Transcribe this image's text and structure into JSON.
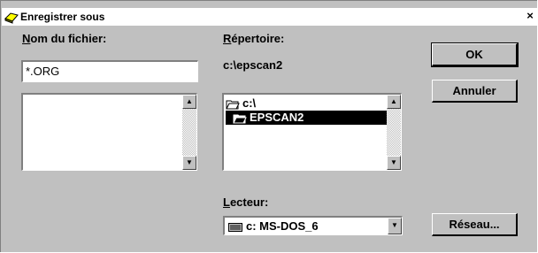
{
  "window": {
    "title": "Enregistrer sous",
    "close_symbol": "×"
  },
  "filename": {
    "label": "Nom du fichier:",
    "label_accel": "N",
    "label_rest": "om du fichier:",
    "value": "*.ORG"
  },
  "directory": {
    "label_accel": "R",
    "label_rest": "épertoire:",
    "current_path": "c:\\epscan2",
    "items": [
      {
        "label": "c:\\",
        "icon": "open-folder-icon",
        "selected": false
      },
      {
        "label": "EPSCAN2",
        "icon": "open-folder-icon",
        "selected": true
      }
    ]
  },
  "drive": {
    "label_accel": "L",
    "label_rest": "ecteur:",
    "value": "c: MS-DOS_6",
    "icon": "drive-icon"
  },
  "buttons": {
    "ok": "OK",
    "cancel": "Annuler",
    "network": "Réseau..."
  },
  "scroll": {
    "up": "▲",
    "down": "▼"
  },
  "colors": {
    "dialog_bg": "#c0c0c0",
    "selection": "#000000"
  }
}
